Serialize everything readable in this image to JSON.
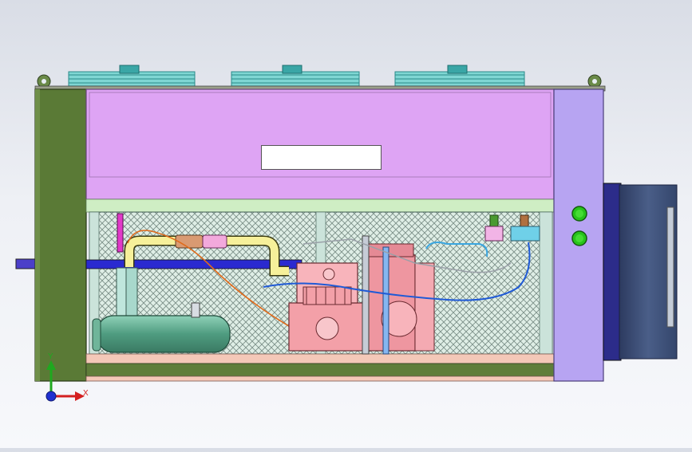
{
  "viewport": {
    "background_top": "#d9dde6",
    "background_bottom": "#f7f8fb"
  },
  "model": {
    "nameplate_text": "",
    "colors": {
      "left_frame": "#5a7a36",
      "top_housing": "#dea4f4",
      "right_panel": "#b7a4f2",
      "base_rail": "#f4c8b8",
      "green_rail": "#5f7d3a",
      "fan_guard": "#3aa6a6",
      "condenser_box": "#3f5278",
      "compressor": "#f3a0a8",
      "receiver_tank": "#5aa88a",
      "suction_pipe": "#2a2ad0",
      "liquid_pipe": "#f6f09a",
      "indicator_lamp": "#27c41a"
    },
    "icons": [
      "fan-guard-icon",
      "lifting-eye-icon",
      "indicator-lamp-icon"
    ]
  },
  "triad": {
    "y_label": "Y",
    "x_label": "X",
    "y_color": "#1fa81f",
    "x_color": "#d42020",
    "z_color": "#2030d0"
  }
}
